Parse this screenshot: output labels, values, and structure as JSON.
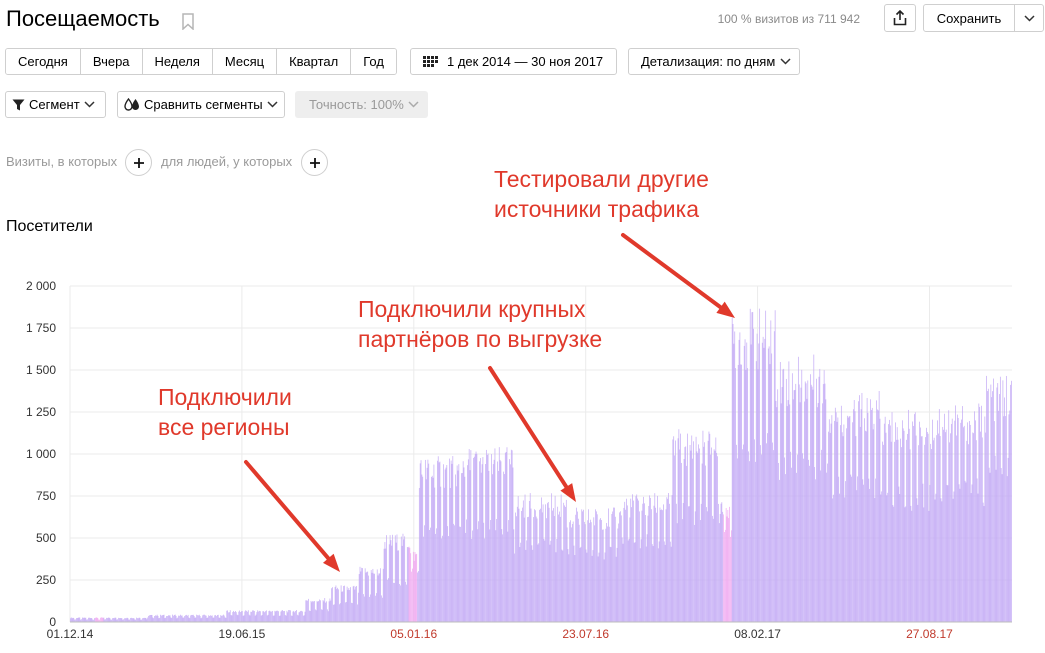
{
  "header": {
    "title": "Посещаемость",
    "visits_summary": "100 % визитов из 711 942",
    "save_label": "Сохранить"
  },
  "periods": [
    "Сегодня",
    "Вчера",
    "Неделя",
    "Месяц",
    "Квартал",
    "Год"
  ],
  "date_range": "1 дек 2014 — 30 ноя 2017",
  "detail": "Детализация: по дням",
  "segment_label": "Сегмент",
  "compare_label": "Сравнить сегменты",
  "accuracy_label": "Точность: 100%",
  "filters": {
    "visits_text": "Визиты, в которых",
    "people_text": "для людей, у которых"
  },
  "chart_heading": "Посетители",
  "colors": {
    "bar": "#c3aaf5",
    "bar_highlight": "#f0a8f0",
    "annotation": "#e0392b",
    "holiday_tick": "#c0392b"
  },
  "annotations": [
    {
      "lines": [
        "Подключили",
        "все регионы"
      ]
    },
    {
      "lines": [
        "Подключили крупных",
        "партнёров по выгрузке"
      ]
    },
    {
      "lines": [
        "Тестировали другие",
        "источники трафика"
      ]
    }
  ],
  "chart_data": {
    "type": "bar",
    "title": "",
    "xlabel": "",
    "ylabel": "",
    "ylim": [
      0,
      2000
    ],
    "y_ticks": [
      "0",
      "250",
      "500",
      "750",
      "1 000",
      "1 250",
      "1 500",
      "1 750",
      "2 000"
    ],
    "x_ticks": [
      {
        "label": "01.12.14",
        "date": "2014-12-01",
        "holiday": false
      },
      {
        "label": "19.06.15",
        "date": "2015-06-19",
        "holiday": false
      },
      {
        "label": "05.01.16",
        "date": "2016-01-05",
        "holiday": true
      },
      {
        "label": "23.07.16",
        "date": "2016-07-23",
        "holiday": true
      },
      {
        "label": "08.02.17",
        "date": "2017-02-08",
        "holiday": false
      },
      {
        "label": "27.08.17",
        "date": "2017-08-27",
        "holiday": true
      }
    ],
    "x_range": [
      "2014-12-01",
      "2017-11-30"
    ],
    "grid": true,
    "series": [
      {
        "values_by_period": [
          {
            "from": "2014-12-01",
            "to": "2015-02-28",
            "weekday": 25,
            "weekend": 15
          },
          {
            "from": "2015-03-01",
            "to": "2015-05-31",
            "weekday": 40,
            "weekend": 25
          },
          {
            "from": "2015-06-01",
            "to": "2015-08-31",
            "weekday": 65,
            "weekend": 40
          },
          {
            "from": "2015-09-01",
            "to": "2015-09-30",
            "weekday": 130,
            "weekend": 70
          },
          {
            "from": "2015-10-01",
            "to": "2015-10-31",
            "weekday": 200,
            "weekend": 110
          },
          {
            "from": "2015-11-01",
            "to": "2015-11-30",
            "weekday": 300,
            "weekend": 160
          },
          {
            "from": "2015-12-01",
            "to": "2015-12-31",
            "weekday": 480,
            "weekend": 240
          },
          {
            "from": "2016-01-01",
            "to": "2016-01-10",
            "weekday": 400,
            "weekend": 300
          },
          {
            "from": "2016-01-11",
            "to": "2016-02-29",
            "weekday": 900,
            "weekend": 550
          },
          {
            "from": "2016-03-01",
            "to": "2016-04-30",
            "weekday": 950,
            "weekend": 560
          },
          {
            "from": "2016-05-01",
            "to": "2016-06-30",
            "weekday": 700,
            "weekend": 450
          },
          {
            "from": "2016-07-01",
            "to": "2016-08-31",
            "weekday": 620,
            "weekend": 420
          },
          {
            "from": "2016-09-01",
            "to": "2016-10-31",
            "weekday": 700,
            "weekend": 480
          },
          {
            "from": "2016-11-01",
            "to": "2016-12-25",
            "weekday": 1050,
            "weekend": 650
          },
          {
            "from": "2016-12-26",
            "to": "2017-01-08",
            "weekday": 700,
            "weekend": 500
          },
          {
            "from": "2017-01-09",
            "to": "2017-02-28",
            "weekday": 1700,
            "weekend": 1050
          },
          {
            "from": "2017-03-01",
            "to": "2017-04-30",
            "weekday": 1450,
            "weekend": 950
          },
          {
            "from": "2017-05-01",
            "to": "2017-06-30",
            "weekday": 1250,
            "weekend": 800
          },
          {
            "from": "2017-07-01",
            "to": "2017-08-31",
            "weekday": 1150,
            "weekend": 750
          },
          {
            "from": "2017-09-01",
            "to": "2017-10-31",
            "weekday": 1200,
            "weekend": 780
          },
          {
            "from": "2017-11-01",
            "to": "2017-11-30",
            "weekday": 1350,
            "weekend": 900
          }
        ]
      }
    ]
  }
}
